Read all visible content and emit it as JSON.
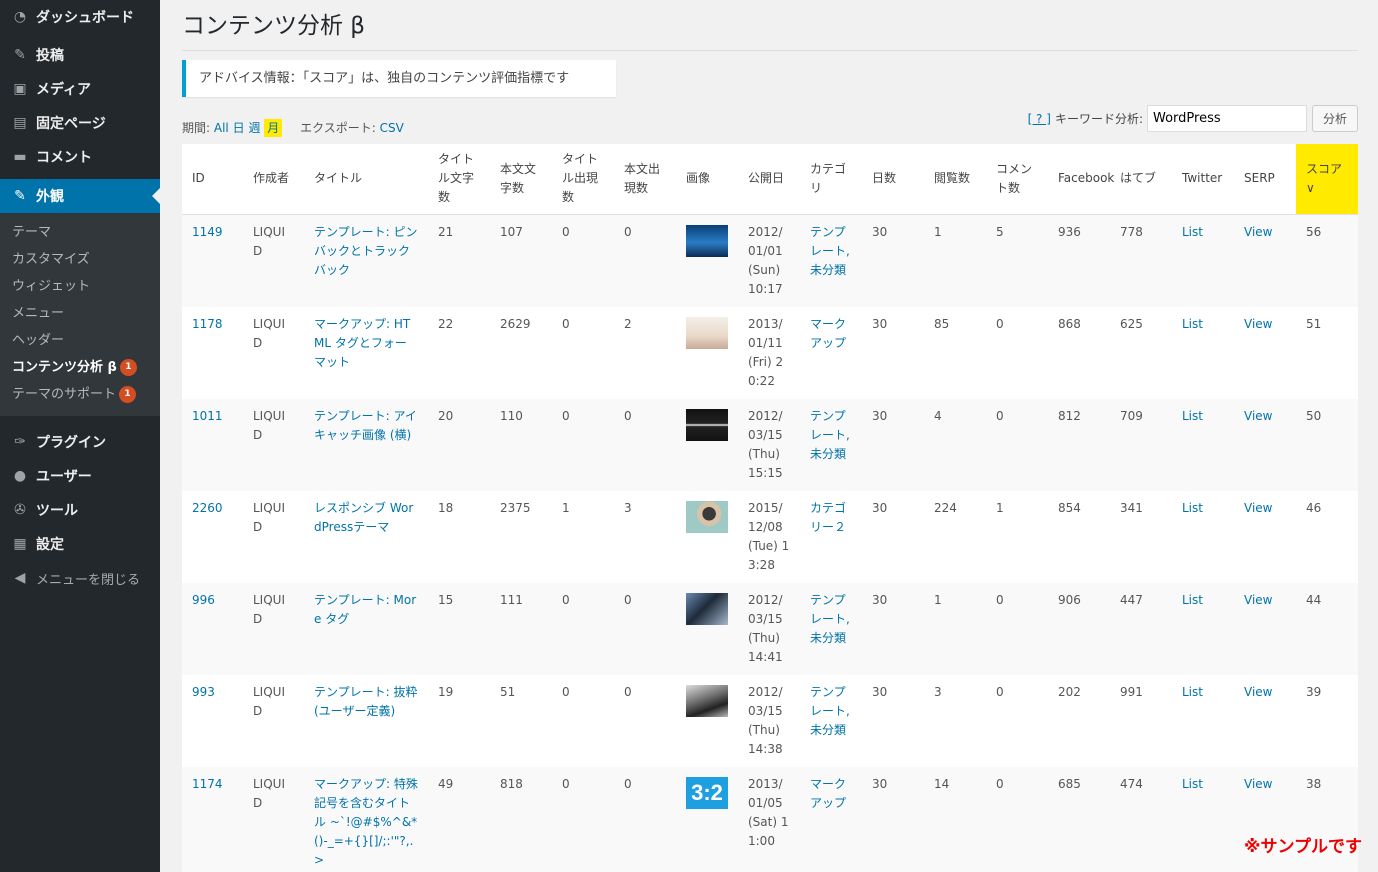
{
  "sidebar": {
    "top": [
      {
        "label": "ダッシュボード",
        "icon": "dashboard-icon",
        "glyph": "◔"
      }
    ],
    "items": [
      {
        "label": "投稿",
        "icon": "pin-icon",
        "glyph": "✎"
      },
      {
        "label": "メディア",
        "icon": "media-icon",
        "glyph": "▣"
      },
      {
        "label": "固定ページ",
        "icon": "page-icon",
        "glyph": "▤"
      },
      {
        "label": "コメント",
        "icon": "comment-icon",
        "glyph": "▬"
      }
    ],
    "current": {
      "label": "外観",
      "icon": "appearance-icon",
      "glyph": "✎"
    },
    "submenu": [
      {
        "label": "テーマ",
        "badge": ""
      },
      {
        "label": "カスタマイズ",
        "badge": ""
      },
      {
        "label": "ウィジェット",
        "badge": ""
      },
      {
        "label": "メニュー",
        "badge": ""
      },
      {
        "label": "ヘッダー",
        "badge": ""
      },
      {
        "label": "コンテンツ分析 β",
        "badge": "1",
        "active": true
      },
      {
        "label": "テーマのサポート",
        "badge": "1"
      }
    ],
    "bottom": [
      {
        "label": "プラグイン",
        "icon": "plugin-icon",
        "glyph": "✑"
      },
      {
        "label": "ユーザー",
        "icon": "user-icon",
        "glyph": "●"
      },
      {
        "label": "ツール",
        "icon": "tool-icon",
        "glyph": "✇"
      },
      {
        "label": "設定",
        "icon": "settings-icon",
        "glyph": "▦"
      }
    ],
    "collapse": {
      "label": "メニューを閉じる",
      "glyph": "◀"
    }
  },
  "page": {
    "title": "コンテンツ分析 β",
    "notice": "アドバイス情報：「スコア」は、独自のコンテンツ評価指標です"
  },
  "toolbar": {
    "period_label": "期間:",
    "periods": [
      "All",
      "日",
      "週",
      "月"
    ],
    "selected_period": "月",
    "export_label": "エクスポート:",
    "export_csv": "CSV",
    "help": "[ ? ]",
    "keyword_label": "キーワード分析:",
    "keyword_value": "WordPress",
    "analyze_button": "分析"
  },
  "table": {
    "headers": [
      "ID",
      "作成者",
      "タイトル",
      "タイトル文字数",
      "本文文字数",
      "タイトル出現数",
      "本文出現数",
      "画像",
      "公開日",
      "カテゴリ",
      "日数",
      "閲覧数",
      "コメント数",
      "Facebook",
      "はてブ",
      "Twitter",
      "SERP",
      "スコア∨"
    ],
    "rows": [
      {
        "id": "1149",
        "author": "LIQUID",
        "title": "テンプレート: ピンバックとトラックバック",
        "tlen": "21",
        "blen": "107",
        "tcnt": "0",
        "bcnt": "0",
        "thumb": "ocean",
        "date": "2012/01/01 (Sun) 10:17",
        "cat": "テンプレート,未分類",
        "days": "30",
        "views": "1",
        "comments": "5",
        "fb": "936",
        "hatebu": "778",
        "twitter": "List",
        "serp": "View",
        "score": "56"
      },
      {
        "id": "1178",
        "author": "LIQUID",
        "title": "マークアップ: HTML タグとフォーマット",
        "tlen": "22",
        "blen": "2629",
        "tcnt": "0",
        "bcnt": "2",
        "thumb": "beach",
        "date": "2013/01/11 (Fri) 20:22",
        "cat": "マークアップ",
        "days": "30",
        "views": "85",
        "comments": "0",
        "fb": "868",
        "hatebu": "625",
        "twitter": "List",
        "serp": "View",
        "score": "51"
      },
      {
        "id": "1011",
        "author": "LIQUID",
        "title": "テンプレート: アイキャッチ画像 (横)",
        "tlen": "20",
        "blen": "110",
        "tcnt": "0",
        "bcnt": "0",
        "thumb": "dark",
        "date": "2012/03/15 (Thu) 15:15",
        "cat": "テンプレート,未分類",
        "days": "30",
        "views": "4",
        "comments": "0",
        "fb": "812",
        "hatebu": "709",
        "twitter": "List",
        "serp": "View",
        "score": "50"
      },
      {
        "id": "2260",
        "author": "LIQUID",
        "title": "レスポンシブ WordPressテーマ",
        "tlen": "18",
        "blen": "2375",
        "tcnt": "1",
        "bcnt": "3",
        "thumb": "person",
        "date": "2015/12/08 (Tue) 13:28",
        "cat": "カテゴリー２",
        "days": "30",
        "views": "224",
        "comments": "1",
        "fb": "854",
        "hatebu": "341",
        "twitter": "List",
        "serp": "View",
        "score": "46"
      },
      {
        "id": "996",
        "author": "LIQUID",
        "title": "テンプレート: More タグ",
        "tlen": "15",
        "blen": "111",
        "tcnt": "0",
        "bcnt": "0",
        "thumb": "bridge",
        "date": "2012/03/15 (Thu) 14:41",
        "cat": "テンプレート,未分類",
        "days": "30",
        "views": "1",
        "comments": "0",
        "fb": "906",
        "hatebu": "447",
        "twitter": "List",
        "serp": "View",
        "score": "44"
      },
      {
        "id": "993",
        "author": "LIQUID",
        "title": "テンプレート: 抜粋 (ユーザー定義)",
        "tlen": "19",
        "blen": "51",
        "tcnt": "0",
        "bcnt": "0",
        "thumb": "bw",
        "date": "2012/03/15 (Thu) 14:38",
        "cat": "テンプレート,未分類",
        "days": "30",
        "views": "3",
        "comments": "0",
        "fb": "202",
        "hatebu": "991",
        "twitter": "List",
        "serp": "View",
        "score": "39"
      },
      {
        "id": "1174",
        "author": "LIQUID",
        "title": "マークアップ: 特殊記号を含むタイトル ~`!@#$%^&*()-_=+{}[]/;:'\"?,.>",
        "tlen": "49",
        "blen": "818",
        "tcnt": "0",
        "bcnt": "0",
        "thumb": "ratio",
        "thumb_text": "3:2",
        "date": "2013/01/05 (Sat) 11:00",
        "cat": "マークアップ",
        "days": "30",
        "views": "14",
        "comments": "0",
        "fb": "685",
        "hatebu": "474",
        "twitter": "List",
        "serp": "View",
        "score": "38"
      }
    ]
  },
  "sample_note": "※サンプルです"
}
